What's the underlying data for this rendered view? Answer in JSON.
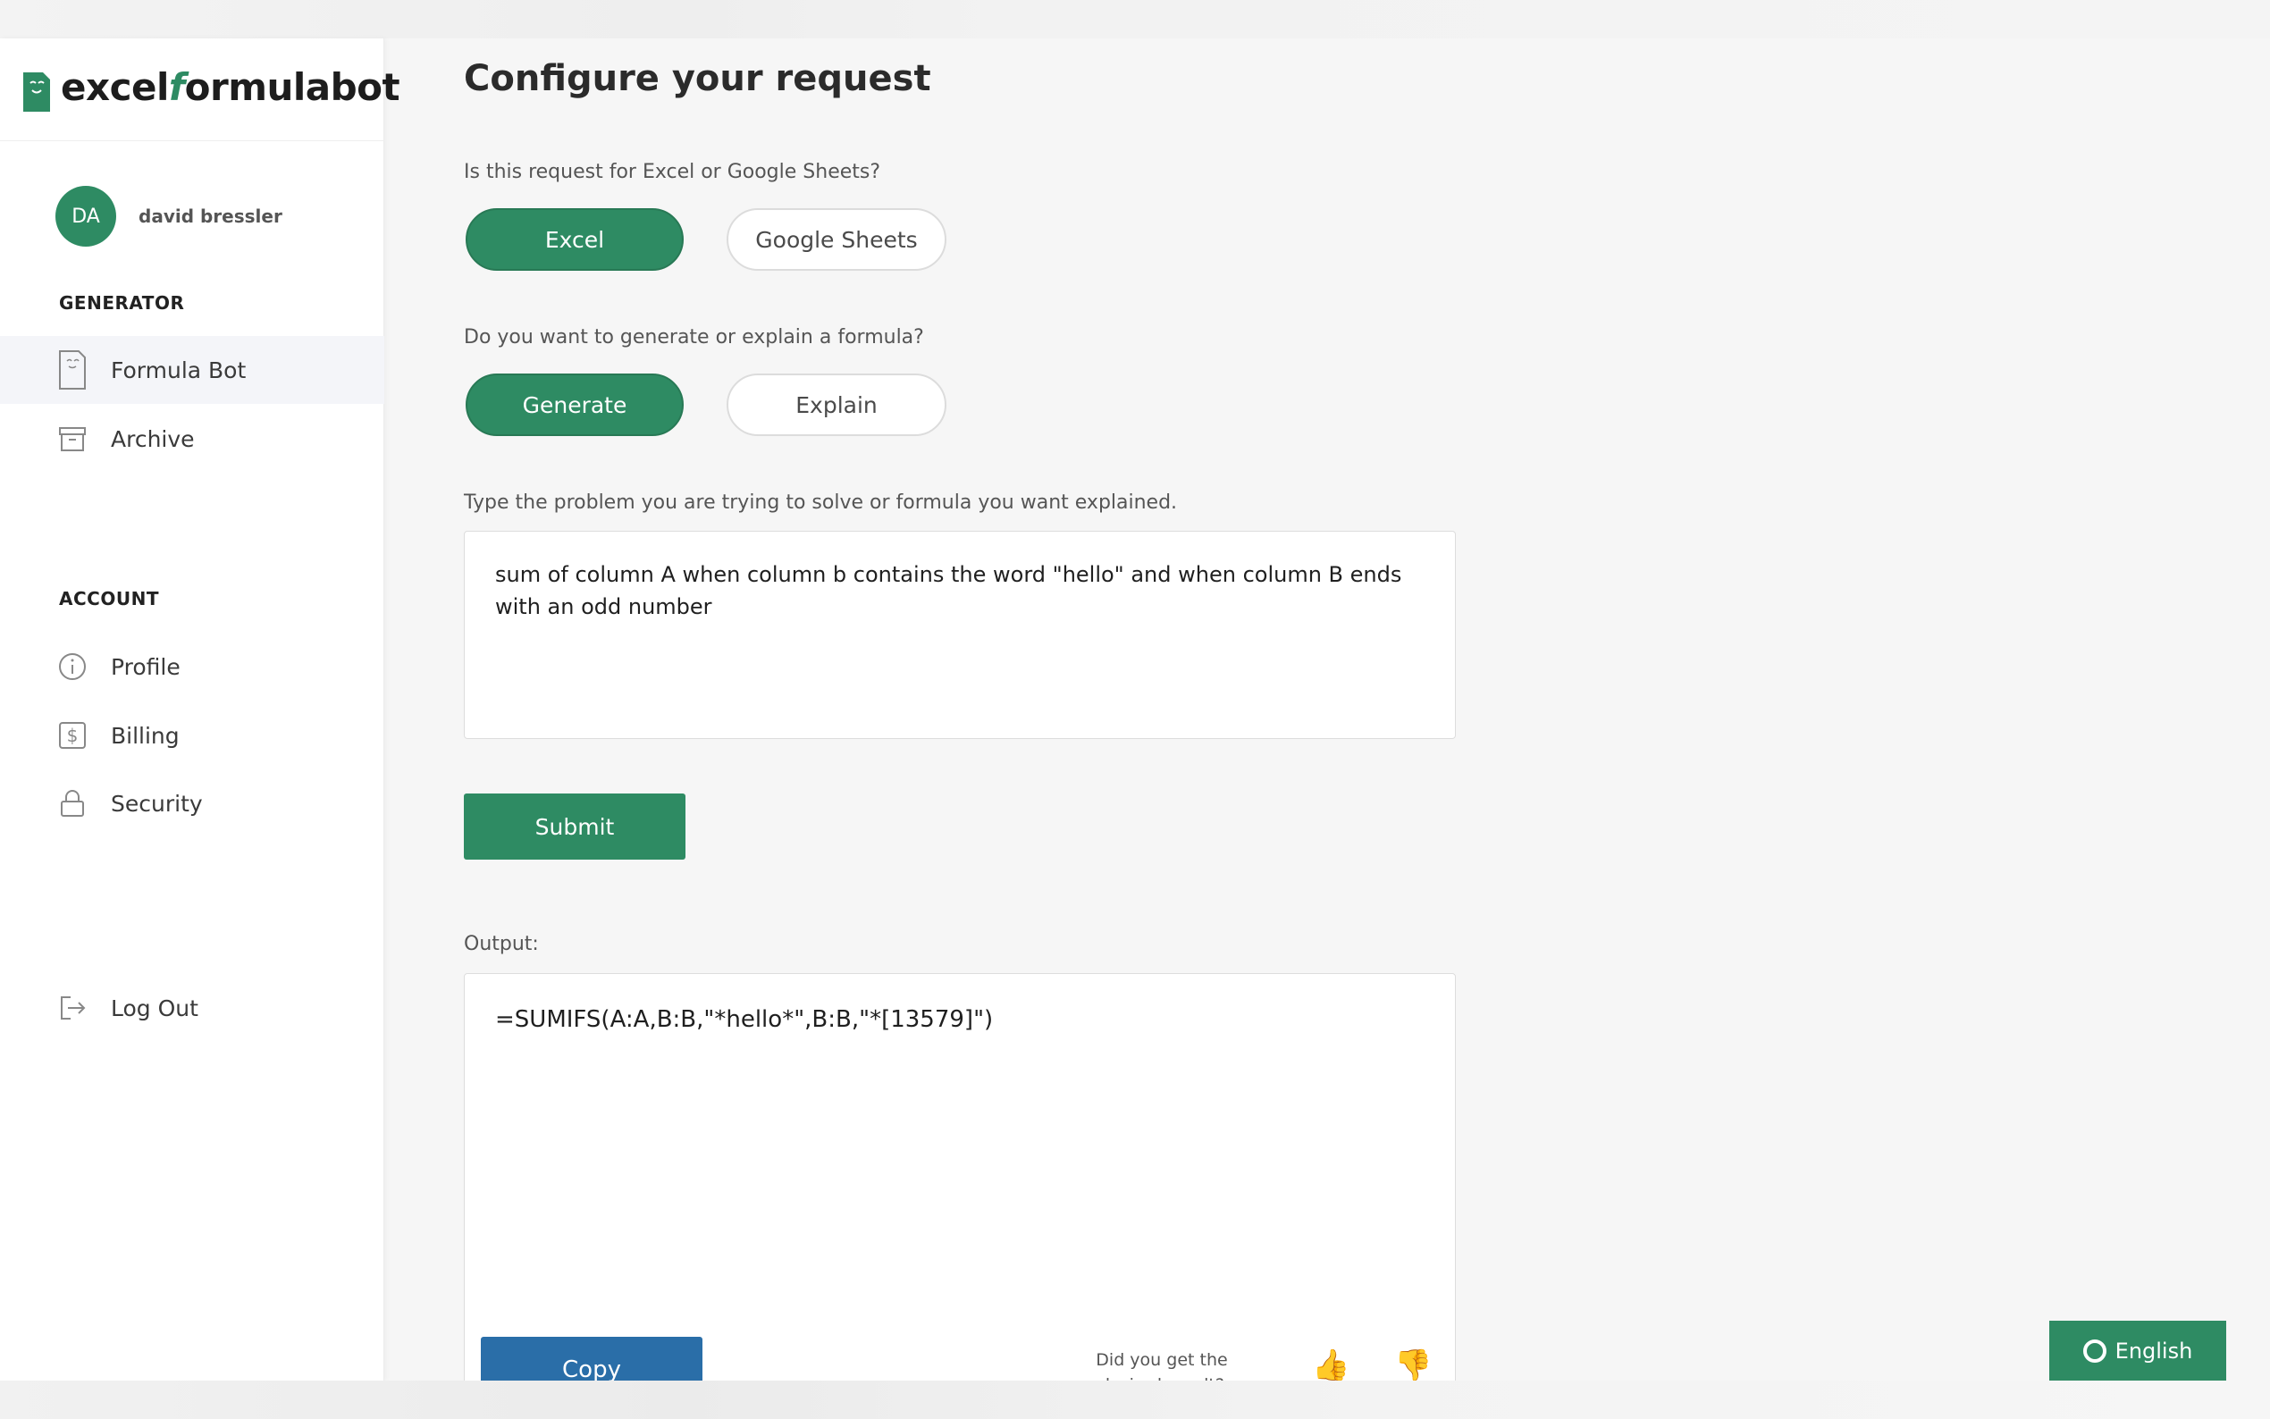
{
  "brand": {
    "name_part1": "excel",
    "name_f": "f",
    "name_part2": "ormulabot",
    "accent_color": "#2e8b63"
  },
  "user": {
    "initials": "DA",
    "name": "david bressler"
  },
  "sidebar": {
    "generator_label": "GENERATOR",
    "account_label": "ACCOUNT",
    "items": [
      {
        "label": "Formula Bot",
        "icon": "formula-bot-icon"
      },
      {
        "label": "Archive",
        "icon": "archive-icon"
      },
      {
        "label": "Profile",
        "icon": "info-icon"
      },
      {
        "label": "Billing",
        "icon": "dollar-icon"
      },
      {
        "label": "Security",
        "icon": "lock-icon"
      },
      {
        "label": "Log Out",
        "icon": "logout-icon"
      }
    ]
  },
  "main": {
    "title": "Configure your request",
    "platform_question": "Is this request for Excel or Google Sheets?",
    "platform_options": [
      "Excel",
      "Google Sheets"
    ],
    "mode_question": "Do you want to generate or explain a formula?",
    "mode_options": [
      "Generate",
      "Explain"
    ],
    "input_label": "Type the problem you are trying to solve or formula you want explained.",
    "input_value": "sum of column A when column b contains the word \"hello\" and when column B ends with an odd number",
    "submit_label": "Submit",
    "output_label": "Output:",
    "output_value": "=SUMIFS(A:A,B:B,\"*hello*\",B:B,\"*[13579]\")",
    "copy_label": "Copy",
    "feedback_question": "Did you get the desired result?",
    "thumbs_up": "👍",
    "thumbs_down": "👎"
  },
  "language": {
    "label": "English"
  }
}
